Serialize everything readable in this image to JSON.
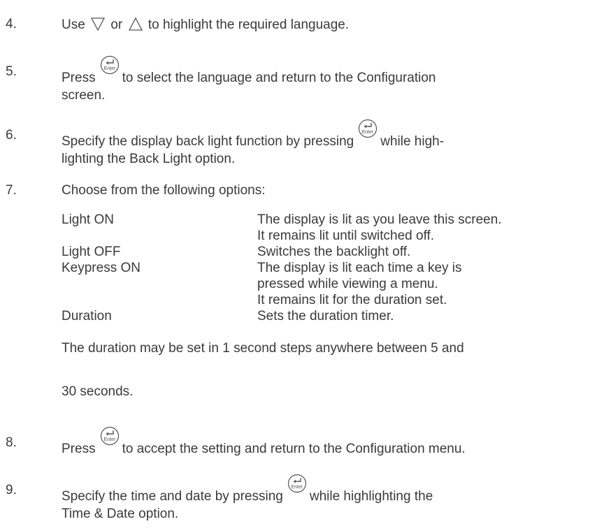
{
  "steps": {
    "s4": {
      "num": "4.",
      "pre": "Use",
      "mid": "or",
      "post": "to highlight the required language."
    },
    "s5": {
      "num": "5.",
      "pre": "Press",
      "post": "to select the language and return to the Configuration",
      "line2": "screen."
    },
    "s6": {
      "num": "6.",
      "pre": "Specify the display back light function by pressing",
      "post": "while high-",
      "line2": "lighting the Back Light option."
    },
    "s7": {
      "num": "7.",
      "text": "Choose from the following options:"
    },
    "s8": {
      "num": "8.",
      "pre": "Press",
      "post": "to accept the setting and return to the Configuration menu."
    },
    "s9": {
      "num": "9.",
      "pre": "Specify the time and date by pressing",
      "post": "while highlighting the",
      "line2": "Time & Date option."
    }
  },
  "options": [
    {
      "name": "Light ON",
      "desc": [
        "The display is lit as you leave this screen.",
        "It remains lit until switched off."
      ]
    },
    {
      "name": "Light OFF",
      "desc": [
        "Switches the backlight off."
      ]
    },
    {
      "name": "Keypress ON",
      "desc": [
        "The display is lit each time a key is",
        "pressed while viewing a menu.",
        "It remains lit for the duration set."
      ]
    },
    {
      "name": "Duration",
      "desc": [
        "Sets the duration timer."
      ]
    }
  ],
  "duration_note": {
    "line1": "The duration may be set in 1 second steps anywhere between 5 and",
    "line2": "30 seconds."
  },
  "icons": {
    "down": "down-triangle-icon",
    "up": "up-triangle-icon",
    "enter": "enter-key-icon",
    "enter_label": "Enter"
  }
}
